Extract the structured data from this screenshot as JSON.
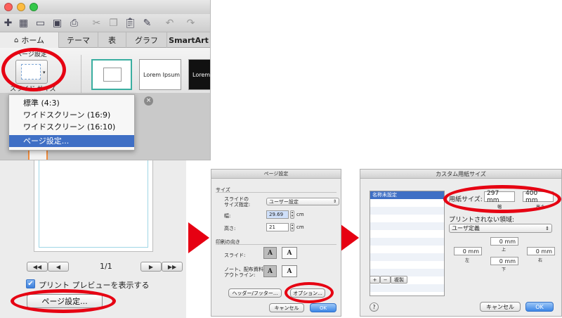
{
  "ribbon": {
    "tabs": [
      "ホーム",
      "テーマ",
      "表",
      "グラフ",
      "SmartArt"
    ],
    "group_label": "ページ設定",
    "slide_size_label": "スライド サイズ",
    "thumb_labels": [
      "Lorem Ipsum",
      "Lorem I"
    ],
    "dropdown_items": [
      "標準 (4:3)",
      "ワイドスクリーン (16:9)",
      "ワイドスクリーン (16:10)"
    ],
    "dropdown_selected": "ページ設定..."
  },
  "print_dialog": {
    "page_counter": "1/1",
    "show_preview_label": "プリント プレビューを表示する",
    "page_setup_button": "ページ設定..."
  },
  "page_setup": {
    "title": "ページ設定",
    "section_size": "サイズ",
    "slide_size_label": "スライドの\nサイズ指定:",
    "slide_size_value": "ユーザー設定",
    "width_label": "幅:",
    "width_value": "29.69",
    "height_label": "高さ:",
    "height_value": "21",
    "unit": "cm",
    "section_orientation": "印刷の向き",
    "slides_label": "スライド:",
    "notes_label": "ノート、配布資料、\nアウトライン:",
    "orient_glyph": "A",
    "header_footer_button": "ヘッダー/フッター...",
    "options_button": "オプション...",
    "cancel_button": "キャンセル",
    "ok_button": "OK"
  },
  "custom_paper": {
    "title": "カスタム用紙サイズ",
    "list_item": "名称未設定",
    "add_btn": "+",
    "remove_btn": "−",
    "duplicate_btn": "複製",
    "paper_size_label": "用紙サイズ:",
    "width_value": "297 mm",
    "height_value": "400 mm",
    "width_caption": "幅",
    "height_caption": "高さ",
    "non_printable_label": "プリントされない領域:",
    "non_printable_value": "ユーザ定義",
    "margin_value": "0 mm",
    "top_caption": "上",
    "left_caption": "左",
    "right_caption": "右",
    "bottom_caption": "下",
    "help": "?",
    "cancel_button": "キャンセル",
    "ok_button": "OK"
  },
  "colors": {
    "highlight_red": "#e60012",
    "selection_blue": "#3f6fc5",
    "ok_blue": "#3c86e6"
  }
}
